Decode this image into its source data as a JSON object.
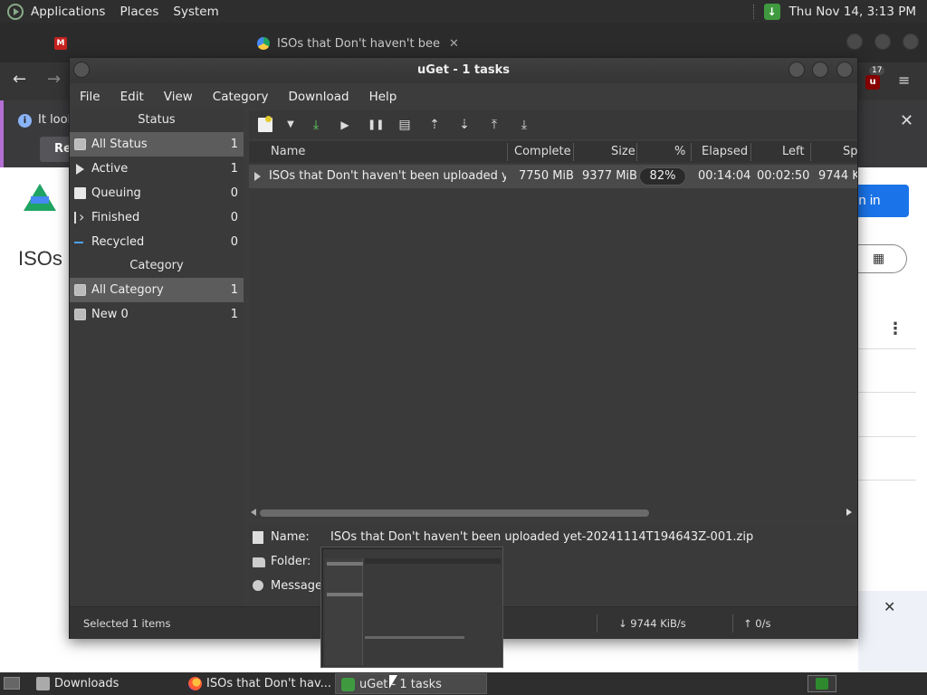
{
  "top_panel": {
    "menus": [
      "Applications",
      "Places",
      "System"
    ],
    "clock": "Thu Nov 14,  3:13 PM"
  },
  "browser": {
    "tabs": [
      {
        "label": "",
        "icon": "gmail-icon"
      },
      {
        "label": "ISOs that Don't haven't bee",
        "icon": "google-drive-icon"
      }
    ],
    "extension_badge": "17",
    "infobar": {
      "text": "It look",
      "button": "Ref"
    },
    "page": {
      "title": "ISOs",
      "signin": "gn in"
    }
  },
  "uget": {
    "title": "uGet - 1 tasks",
    "menu": [
      "File",
      "Edit",
      "View",
      "Category",
      "Download",
      "Help"
    ],
    "status_header": "Status",
    "status_items": [
      {
        "label": "All Status",
        "count": "1"
      },
      {
        "label": "Active",
        "count": "1"
      },
      {
        "label": "Queuing",
        "count": "0"
      },
      {
        "label": "Finished",
        "count": "0"
      },
      {
        "label": "Recycled",
        "count": "0"
      }
    ],
    "category_header": "Category",
    "category_items": [
      {
        "label": "All Category",
        "count": "1"
      },
      {
        "label": "New 0",
        "count": "1"
      }
    ],
    "columns": {
      "name": "Name",
      "complete": "Complete",
      "size": "Size",
      "percent": "%",
      "elapsed": "Elapsed",
      "left": "Left",
      "speed": "Sp"
    },
    "download": {
      "name": "ISOs that Don't haven't been uploaded yet-2",
      "complete": "7750 MiB",
      "size": "9377 MiB",
      "percent": "82%",
      "progress": 0.82,
      "elapsed": "00:14:04",
      "left": "00:02:50",
      "speed": "9744 K"
    },
    "details": {
      "name_label": "Name:",
      "name_value": "ISOs that Don't haven't been uploaded yet-20241114T194643Z-001.zip",
      "folder_label": "Folder:",
      "message_label": "Message:"
    },
    "statusbar": {
      "selected": "Selected 1 items",
      "down_speed": "↓  9744 KiB/s",
      "up_speed": "↑  0/s"
    }
  },
  "taskbar": {
    "tasks": [
      "Downloads",
      "ISOs that Don't hav...",
      "uGet - 1 tasks"
    ]
  },
  "colors": {
    "accent_green": "#3f9a3f",
    "infobar_accent": "#b36fd4",
    "signin_blue": "#1a73e8"
  }
}
